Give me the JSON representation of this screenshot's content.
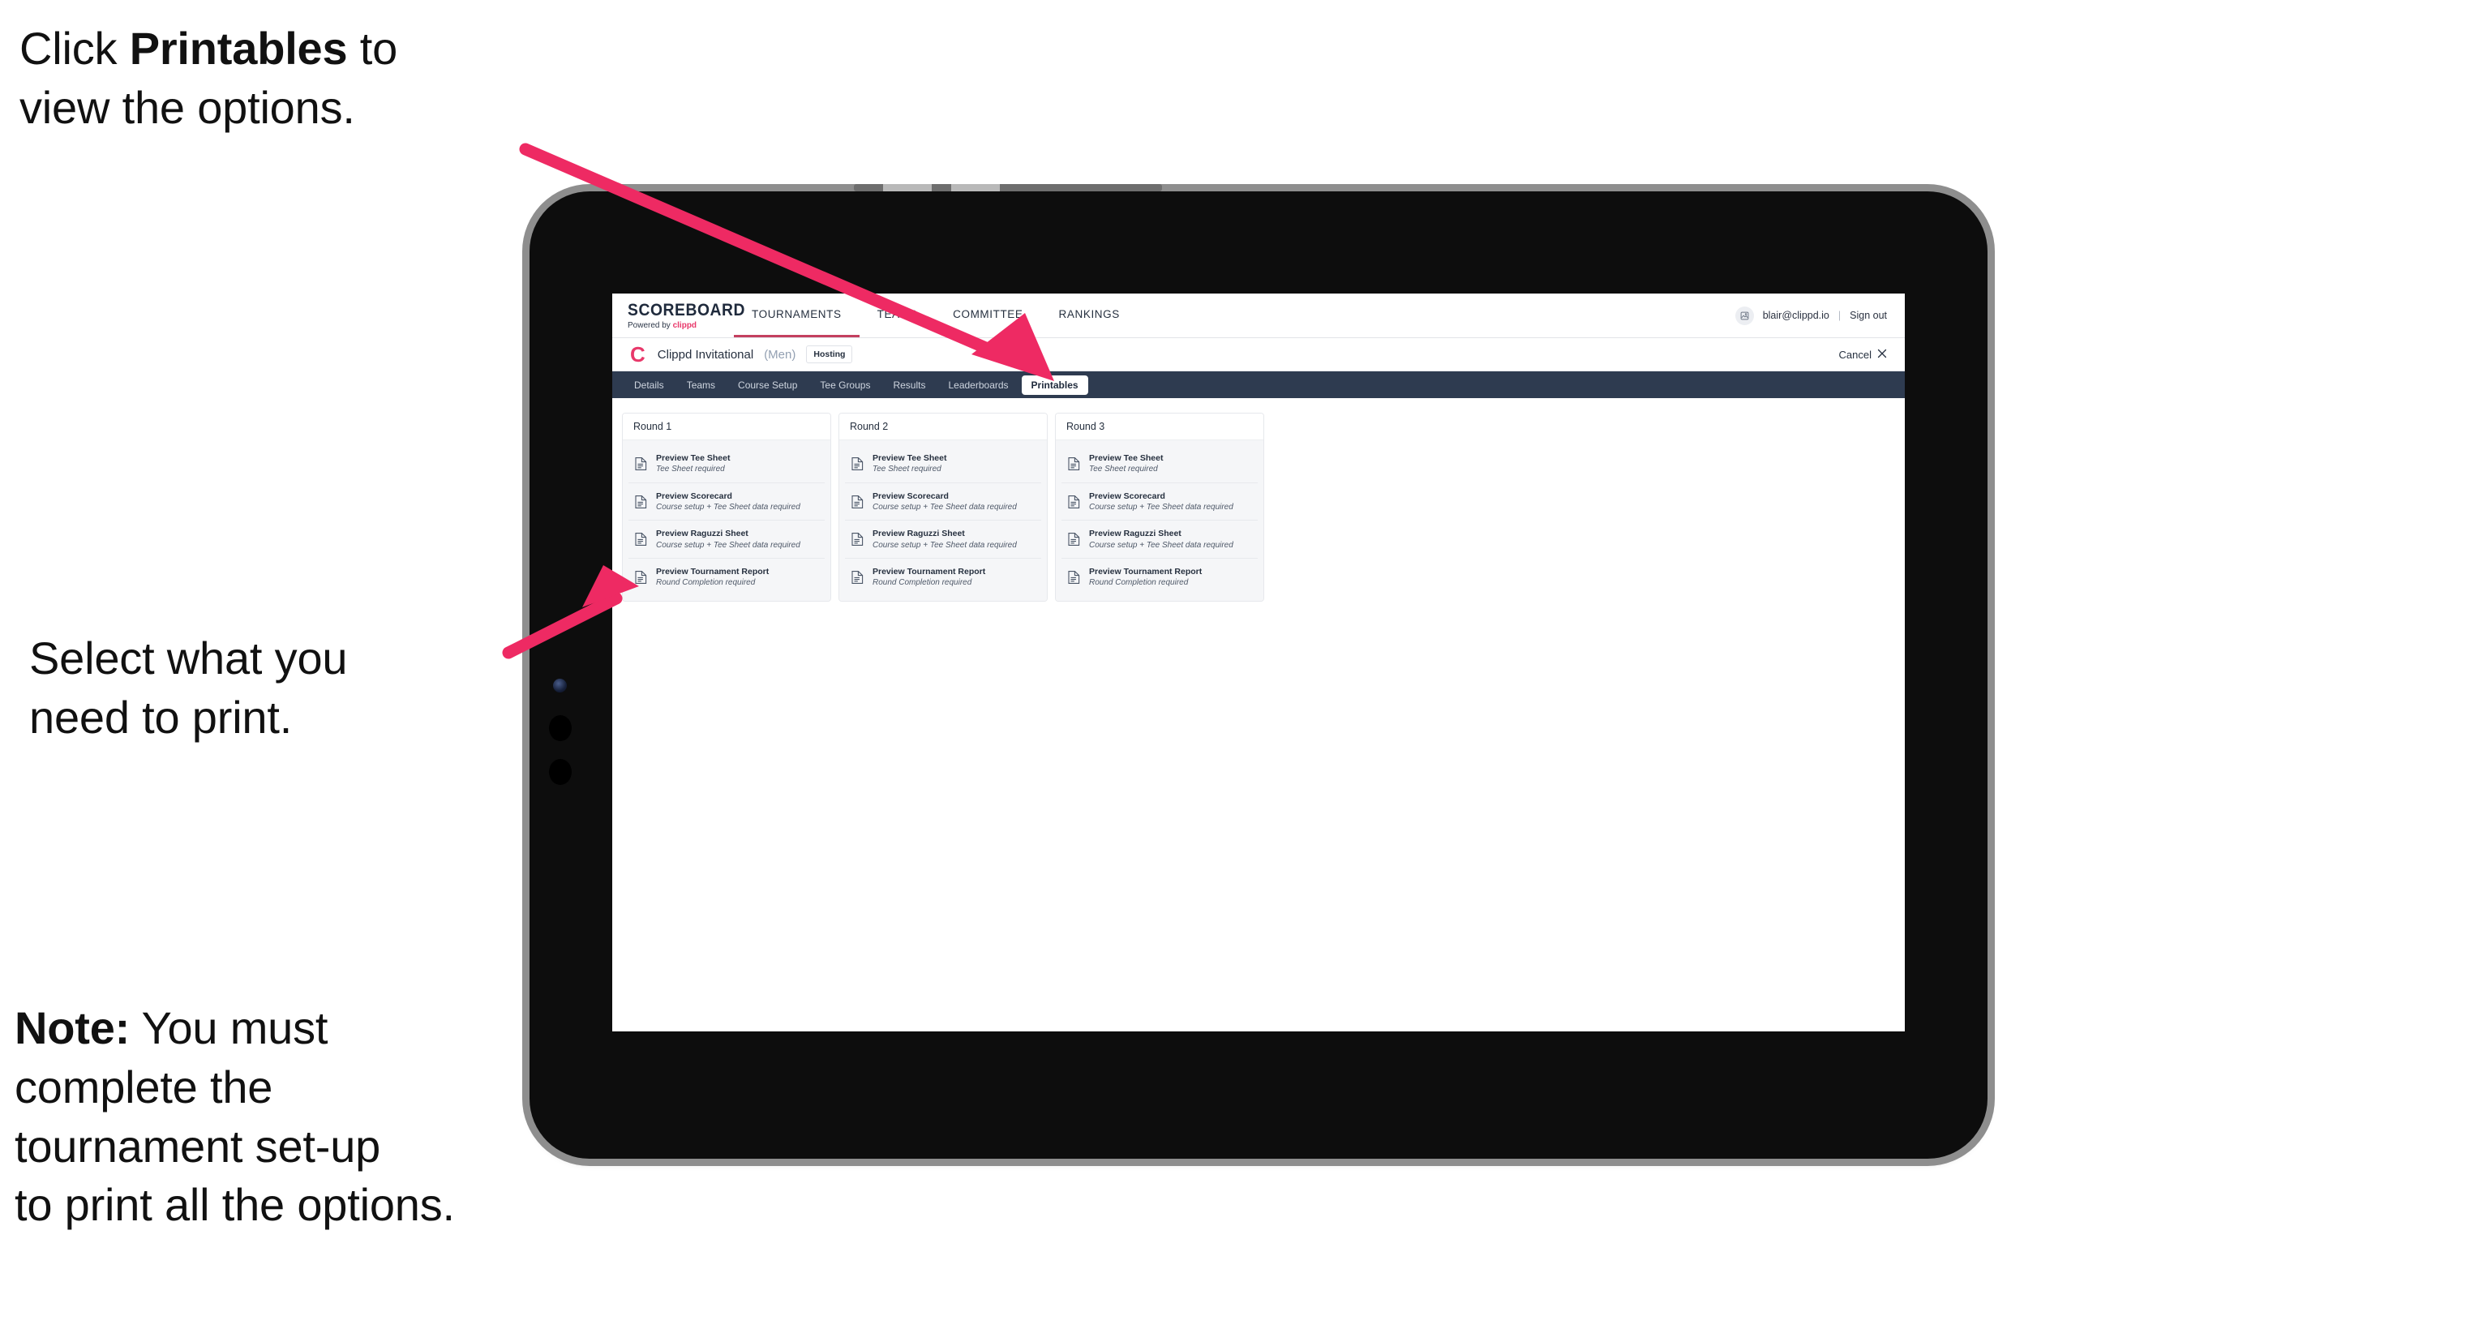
{
  "annotations": {
    "top": "Click Printables to\nview the options.",
    "top_plain_1": "Click ",
    "top_bold": "Printables",
    "top_plain_2": " to\nview the options.",
    "middle": "Select what you\n need to print.",
    "note_bold": "Note:",
    "note_rest": " You must\ncomplete the\ntournament set-up\nto print all the options.",
    "arrow_color": "#ee2a63"
  },
  "app": {
    "logo": {
      "word": "SCOREBOARD",
      "powered_by": "Powered by ",
      "brand": "clippd"
    },
    "main_nav": [
      {
        "label": "TOURNAMENTS",
        "active": true
      },
      {
        "label": "TEAMS",
        "active": false
      },
      {
        "label": "COMMITTEE",
        "active": false
      },
      {
        "label": "RANKINGS",
        "active": false
      }
    ],
    "user": {
      "avatar_icon": "user-avatar-icon",
      "email": "blair@clippd.io",
      "separator": "|",
      "sign_out": "Sign out"
    },
    "tournament": {
      "logo_mark": "C",
      "name": "Clippd Invitational",
      "gender": "(Men)",
      "status_badge": "Hosting",
      "cancel_label": "Cancel",
      "cancel_icon": "close-x-icon"
    },
    "sub_nav": [
      {
        "label": "Details",
        "active": false
      },
      {
        "label": "Teams",
        "active": false
      },
      {
        "label": "Course Setup",
        "active": false
      },
      {
        "label": "Tee Groups",
        "active": false
      },
      {
        "label": "Results",
        "active": false
      },
      {
        "label": "Leaderboards",
        "active": false
      },
      {
        "label": "Printables",
        "active": true
      }
    ],
    "rounds": [
      {
        "title": "Round 1",
        "items": [
          {
            "title": "Preview Tee Sheet",
            "sub": "Tee Sheet required",
            "icon": "document-icon"
          },
          {
            "title": "Preview Scorecard",
            "sub": "Course setup + Tee Sheet data required",
            "icon": "document-icon"
          },
          {
            "title": "Preview Raguzzi Sheet",
            "sub": "Course setup + Tee Sheet data required",
            "icon": "document-icon"
          },
          {
            "title": "Preview Tournament Report",
            "sub": "Round Completion required",
            "icon": "document-icon"
          }
        ]
      },
      {
        "title": "Round 2",
        "items": [
          {
            "title": "Preview Tee Sheet",
            "sub": "Tee Sheet required",
            "icon": "document-icon"
          },
          {
            "title": "Preview Scorecard",
            "sub": "Course setup + Tee Sheet data required",
            "icon": "document-icon"
          },
          {
            "title": "Preview Raguzzi Sheet",
            "sub": "Course setup + Tee Sheet data required",
            "icon": "document-icon"
          },
          {
            "title": "Preview Tournament Report",
            "sub": "Round Completion required",
            "icon": "document-icon"
          }
        ]
      },
      {
        "title": "Round 3",
        "items": [
          {
            "title": "Preview Tee Sheet",
            "sub": "Tee Sheet required",
            "icon": "document-icon"
          },
          {
            "title": "Preview Scorecard",
            "sub": "Course setup + Tee Sheet data required",
            "icon": "document-icon"
          },
          {
            "title": "Preview Raguzzi Sheet",
            "sub": "Course setup + Tee Sheet data required",
            "icon": "document-icon"
          },
          {
            "title": "Preview Tournament Report",
            "sub": "Round Completion required",
            "icon": "document-icon"
          }
        ]
      }
    ]
  },
  "colors": {
    "accent_pink": "#e8386a",
    "subnav_bg": "#2e3b50",
    "device_body": "#0d0d0d",
    "device_edge": "#8e8e8e"
  }
}
